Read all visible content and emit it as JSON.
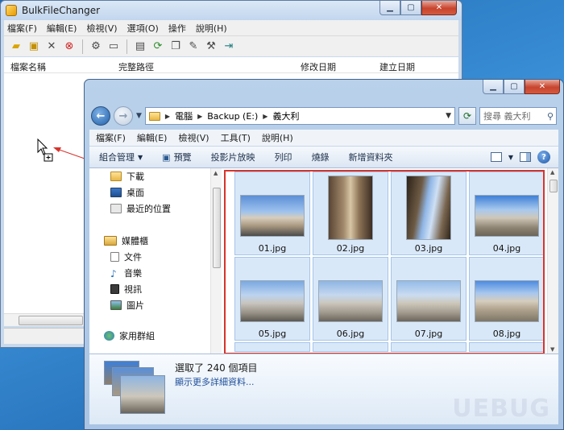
{
  "bulk_window": {
    "title": "BulkFileChanger",
    "menu": [
      "檔案(F)",
      "編輯(E)",
      "檢視(V)",
      "選項(O)",
      "操作",
      "說明(H)"
    ],
    "columns": [
      "檔案名稱",
      "完整路徑",
      "修改日期",
      "建立日期"
    ]
  },
  "explorer": {
    "breadcrumb": [
      "電腦",
      "Backup (E:)",
      "義大利"
    ],
    "search_placeholder": "搜尋 義大利",
    "menu": [
      "檔案(F)",
      "編輯(E)",
      "檢視(V)",
      "工具(T)",
      "說明(H)"
    ],
    "commands": {
      "organize": "組合管理",
      "preview": "預覽",
      "slideshow": "投影片放映",
      "print": "列印",
      "burn": "燒錄",
      "new_folder": "新增資料夾"
    },
    "nav": {
      "downloads": "下載",
      "desktop": "桌面",
      "recent": "最近的位置",
      "libraries": "媒體櫃",
      "documents": "文件",
      "music": "音樂",
      "videos": "視訊",
      "pictures": "圖片",
      "homegroup": "家用群組"
    },
    "files": [
      "01.jpg",
      "02.jpg",
      "03.jpg",
      "04.jpg",
      "05.jpg",
      "06.jpg",
      "07.jpg",
      "08.jpg"
    ],
    "details": {
      "count": "選取了 240 個項目",
      "more": "顯示更多詳細資料..."
    }
  },
  "colors": {
    "selection_box": "#d7342d",
    "drag_arrow": "#d7342d"
  },
  "watermark": "UEBUG"
}
